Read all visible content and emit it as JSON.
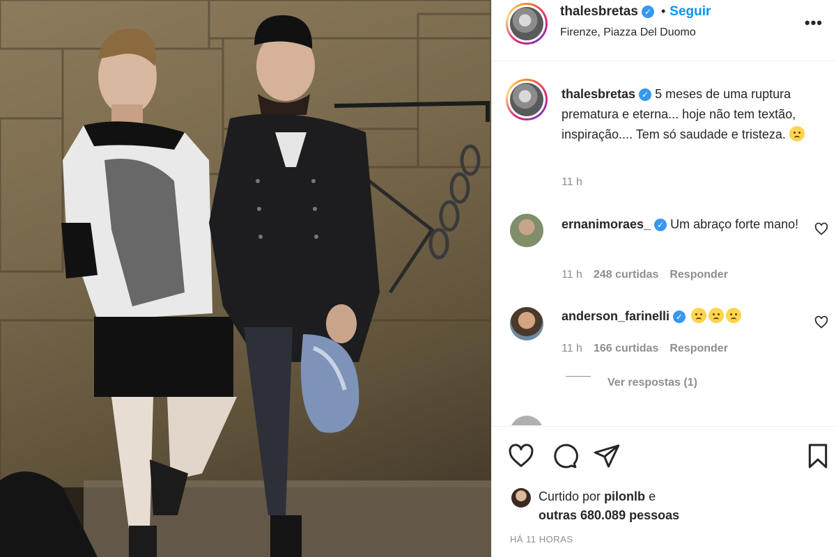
{
  "post": {
    "author": "thalesbretas",
    "follow_label": "Seguir",
    "separator": "•",
    "location": "Firenze, Piazza Del Duomo",
    "more_label": "•••"
  },
  "caption": {
    "username": "thalesbretas",
    "text": "5 meses de uma ruptura prematura e eterna... hoje não tem textão, inspiração.... Tem só saudade e tristeza.",
    "time": "11 h"
  },
  "comments": [
    {
      "username": "ernanimoraes_",
      "text": "Um abraço forte mano!",
      "time": "11 h",
      "likes": "248 curtidas",
      "reply_label": "Responder"
    },
    {
      "username": "anderson_farinelli",
      "emoji_count": 3,
      "time": "11 h",
      "likes": "166 curtidas",
      "reply_label": "Responder"
    }
  ],
  "view_replies": "Ver respostas (1)",
  "likes": {
    "prefix": "Curtido por",
    "user": "pilonlb",
    "conjunction": "e",
    "others": "outras 680.089 pessoas"
  },
  "timestamp": "HÁ 11 HORAS",
  "icons": {
    "verified": "verified-badge-icon",
    "like": "heart-icon",
    "comment": "comment-bubble-icon",
    "share": "paper-plane-icon",
    "save": "bookmark-icon",
    "more": "ellipsis-icon"
  },
  "colors": {
    "accent": "#0095f6",
    "verified": "#3897f0",
    "muted": "#8e8e8e",
    "text": "#262626"
  }
}
